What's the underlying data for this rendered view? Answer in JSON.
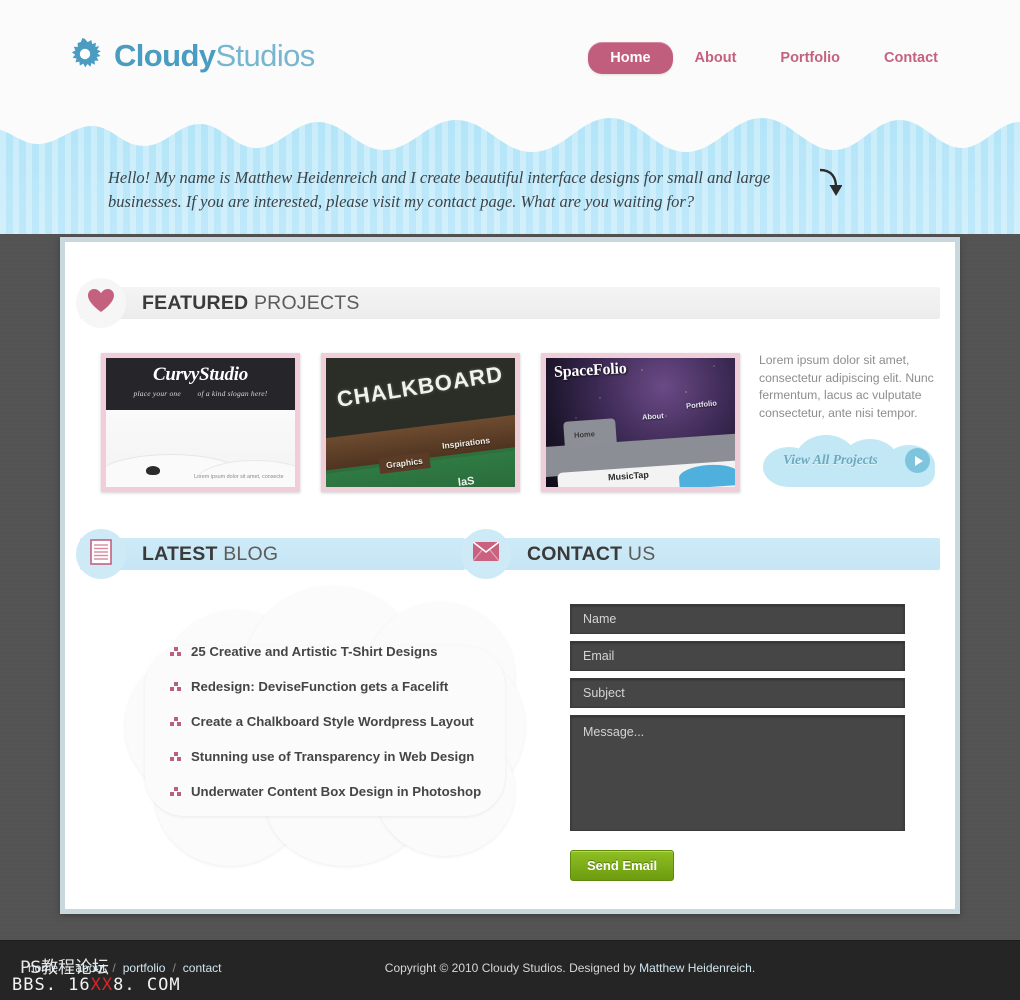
{
  "site": {
    "logo_bold": "Cloudy",
    "logo_light": "Studios",
    "logo_icon": "cloud-burst-icon"
  },
  "nav": {
    "items": [
      {
        "label": "Home",
        "active": true
      },
      {
        "label": "About",
        "active": false
      },
      {
        "label": "Portfolio",
        "active": false
      },
      {
        "label": "Contact",
        "active": false
      }
    ]
  },
  "intro": {
    "text": "Hello!  My name is Matthew Heidenreich and I create beautiful interface designs for small and large businesses.  If you are interested, please visit my contact page.  What are you waiting for?",
    "arrow_icon": "curved-down-arrow-icon"
  },
  "featured": {
    "title_strong": "FEATURED",
    "title_light": "PROJECTS",
    "badge_icon": "heart-icon",
    "projects": [
      {
        "name": "CurvyStudio",
        "brand": "CurvyStudio",
        "slogan_left": "place your one",
        "slogan_right": "of a kind slogan here!",
        "body_text": "Lorem ipsum dolor sit amet, consecte"
      },
      {
        "name": "Chalkboard",
        "title": "CHALKBOARD",
        "tab_a": "Graphics",
        "tab_b": "Inspirations",
        "partial": "laS"
      },
      {
        "name": "SpaceFolio",
        "brand": "SpaceFolio",
        "nav": [
          "Home",
          "About",
          "Portfolio"
        ],
        "card": "MusicTap"
      }
    ],
    "copy": "Lorem ipsum dolor sit amet, consectetur adipiscing elit. Nunc fermentum, lacus ac vulputate consectetur, ante nisi tempor.",
    "view_all_label": "View All Projects",
    "view_all_icon": "play-arrow-icon"
  },
  "blog": {
    "title_strong": "LATEST",
    "title_light": "BLOG",
    "badge_icon": "document-lines-icon",
    "items": [
      "25 Creative and Artistic T-Shirt Designs",
      "Redesign: DeviseFunction gets a Facelift",
      "Create a Chalkboard Style Wordpress Layout",
      "Stunning use of Transparency in Web Design",
      "Underwater Content Box Design in Photoshop"
    ]
  },
  "contact": {
    "title_strong": "CONTACT",
    "title_light": "US",
    "badge_icon": "envelope-icon",
    "name_placeholder": "Name",
    "email_placeholder": "Email",
    "subject_placeholder": "Subject",
    "message_placeholder": "Message...",
    "submit_label": "Send Email"
  },
  "footer": {
    "links": [
      "home",
      "about",
      "portfolio",
      "contact"
    ],
    "separator": "/",
    "copyright_prefix": "Copyright © 2010 Cloudy Studios.  Designed by ",
    "designer": "Matthew Heidenreich",
    "copyright_suffix": "."
  },
  "watermark": {
    "line1": "PS教程论坛",
    "bbs_a": "BBS. 16",
    "bbs_red": "XX",
    "bbs_b": "8. COM"
  },
  "colors": {
    "accent_pink": "#c25e7d",
    "logo_blue": "#4a9cc0",
    "band_blue": "#b2e4f7",
    "green_button": "#7fae18",
    "dark_bg": "#545454"
  }
}
